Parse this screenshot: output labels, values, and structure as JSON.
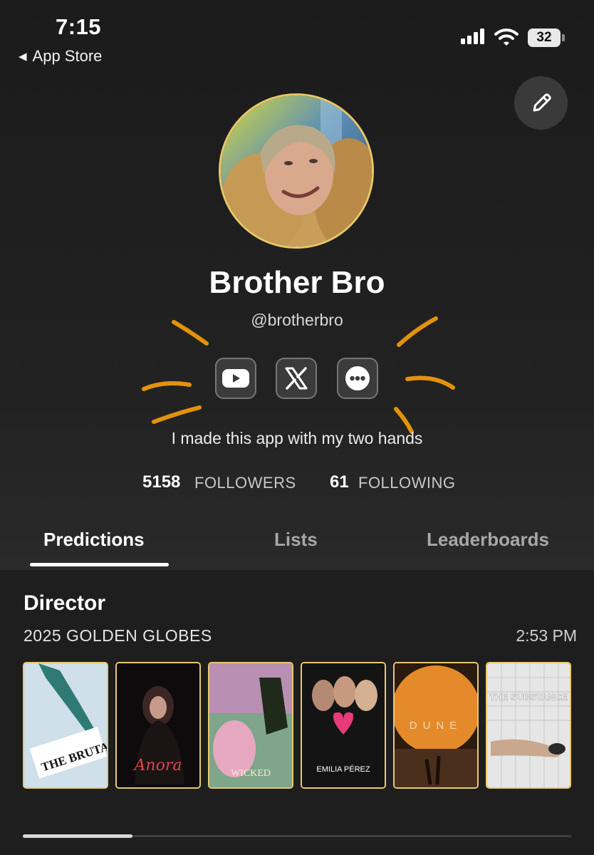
{
  "status_bar": {
    "time": "7:15",
    "back_label": "App Store",
    "battery": "32"
  },
  "profile": {
    "name": "Brother Bro",
    "handle": "@brotherbro",
    "bio": "I made this app with my two hands",
    "followers_count": "5158",
    "followers_label": "FOLLOWERS",
    "following_count": "61",
    "following_label": "FOLLOWING",
    "social_icons": [
      "youtube-icon",
      "x-icon",
      "threads-icon"
    ]
  },
  "tabs": [
    {
      "label": "Predictions",
      "active": true
    },
    {
      "label": "Lists",
      "active": false
    },
    {
      "label": "Leaderboards",
      "active": false
    }
  ],
  "prediction": {
    "category": "Director",
    "event": "2025 GOLDEN GLOBES",
    "time": "2:53 PM",
    "posters": [
      "THE BRUTALIST",
      "Anora",
      "WICKED",
      "EMILIA PÉREZ",
      "DUNE",
      "THE SUBSTANCE"
    ]
  },
  "colors": {
    "accent_gold": "#e8c870",
    "doodle_orange": "#e3920c",
    "background": "#1e1e1e"
  }
}
